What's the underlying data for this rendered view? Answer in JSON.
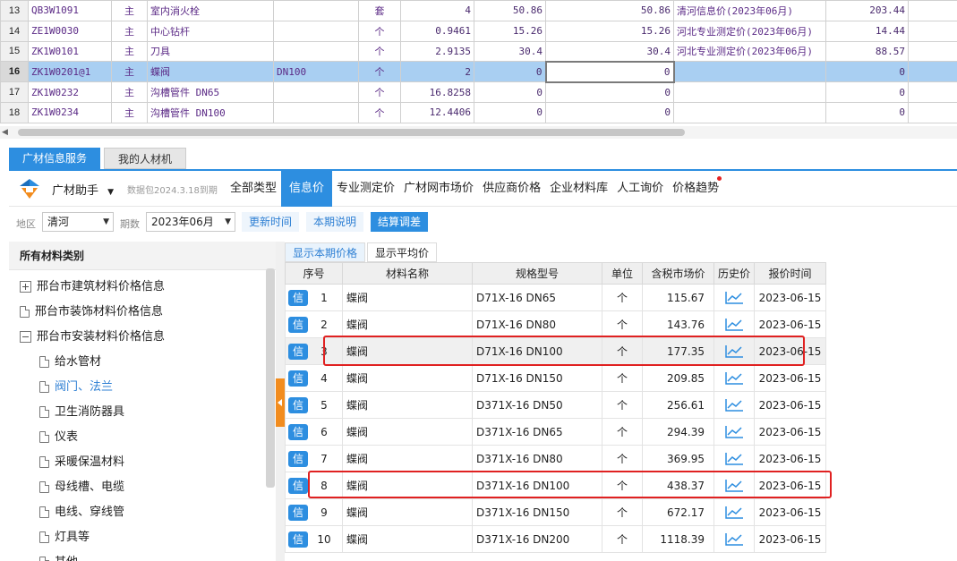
{
  "top_table": {
    "rows": [
      {
        "num": "13",
        "code": "QB3W1091",
        "type": "主",
        "name": "室内消火栓",
        "spec": "",
        "unit": "套",
        "qty": "4",
        "price": "50.86",
        "market": "50.86",
        "source": "清河信息价(2023年06月)",
        "diff": "203.44"
      },
      {
        "num": "14",
        "code": "ZE1W0030",
        "type": "主",
        "name": "中心钻杆",
        "spec": "",
        "unit": "个",
        "qty": "0.9461",
        "price": "15.26",
        "market": "15.26",
        "source": "河北专业测定价(2023年06月)",
        "diff": "14.44"
      },
      {
        "num": "15",
        "code": "ZK1W0101",
        "type": "主",
        "name": "刀具",
        "spec": "",
        "unit": "个",
        "qty": "2.9135",
        "price": "30.4",
        "market": "30.4",
        "source": "河北专业测定价(2023年06月)",
        "diff": "88.57"
      },
      {
        "num": "16",
        "code": "ZK1W0201@1",
        "type": "主",
        "name": "蝶阀",
        "spec": "DN100",
        "unit": "个",
        "qty": "2",
        "price": "0",
        "market": "0",
        "source": "",
        "diff": "0"
      },
      {
        "num": "17",
        "code": "ZK1W0232",
        "type": "主",
        "name": "沟槽管件 DN65",
        "spec": "",
        "unit": "个",
        "qty": "16.8258",
        "price": "0",
        "market": "0",
        "source": "",
        "diff": "0"
      },
      {
        "num": "18",
        "code": "ZK1W0234",
        "type": "主",
        "name": "沟槽管件 DN100",
        "spec": "",
        "unit": "个",
        "qty": "12.4406",
        "price": "0",
        "market": "0",
        "source": "",
        "diff": "0"
      }
    ]
  },
  "tabs_top": {
    "active": "广材信息服务",
    "inactive": "我的人材机"
  },
  "toolbar": {
    "assistant": "广材助手",
    "caret": "▼",
    "version": "数据包2024.3.18到期",
    "nav": [
      "全部类型",
      "信息价",
      "专业测定价",
      "广材网市场价",
      "供应商价格",
      "企业材料库",
      "人工询价",
      "价格趋势"
    ]
  },
  "filters": {
    "region_label": "地区",
    "region": "清河",
    "period_label": "期数",
    "period": "2023年06月",
    "btn_update": "更新时间",
    "btn_desc": "本期说明",
    "btn_settle": "结算调差"
  },
  "left": {
    "header": "所有材料类别",
    "items": [
      "邢台市建筑材料价格信息",
      "邢台市装饰材料价格信息",
      "邢台市安装材料价格信息",
      "给水管材",
      "阀门、法兰",
      "卫生消防器具",
      "仪表",
      "采暖保温材料",
      "母线槽、电缆",
      "电线、穿线管",
      "灯具等",
      "其他"
    ]
  },
  "price_tabs": {
    "current": "显示本期价格",
    "average": "显示平均价"
  },
  "grid": {
    "headers": [
      "序号",
      "材料名称",
      "规格型号",
      "单位",
      "含税市场价",
      "历史价",
      "报价时间"
    ],
    "badge": "信",
    "rows": [
      {
        "no": "1",
        "name": "蝶阀",
        "spec": "D71X-16 DN65",
        "unit": "个",
        "price": "115.67",
        "date": "2023-06-15"
      },
      {
        "no": "2",
        "name": "蝶阀",
        "spec": "D71X-16 DN80",
        "unit": "个",
        "price": "143.76",
        "date": "2023-06-15"
      },
      {
        "no": "3",
        "name": "蝶阀",
        "spec": "D71X-16 DN100",
        "unit": "个",
        "price": "177.35",
        "date": "2023-06-15"
      },
      {
        "no": "4",
        "name": "蝶阀",
        "spec": "D71X-16 DN150",
        "unit": "个",
        "price": "209.85",
        "date": "2023-06-15"
      },
      {
        "no": "5",
        "name": "蝶阀",
        "spec": "D371X-16 DN50",
        "unit": "个",
        "price": "256.61",
        "date": "2023-06-15"
      },
      {
        "no": "6",
        "name": "蝶阀",
        "spec": "D371X-16 DN65",
        "unit": "个",
        "price": "294.39",
        "date": "2023-06-15"
      },
      {
        "no": "7",
        "name": "蝶阀",
        "spec": "D371X-16 DN80",
        "unit": "个",
        "price": "369.95",
        "date": "2023-06-15"
      },
      {
        "no": "8",
        "name": "蝶阀",
        "spec": "D371X-16 DN100",
        "unit": "个",
        "price": "438.37",
        "date": "2023-06-15"
      },
      {
        "no": "9",
        "name": "蝶阀",
        "spec": "D371X-16 DN150",
        "unit": "个",
        "price": "672.17",
        "date": "2023-06-15"
      },
      {
        "no": "10",
        "name": "蝶阀",
        "spec": "D371X-16 DN200",
        "unit": "个",
        "price": "1118.39",
        "date": "2023-06-15"
      }
    ]
  },
  "colors": {
    "accent": "#2d8ee0",
    "selected_row": "#a9cff2",
    "highlight_box": "#e02121",
    "splitter": "#f28c1e"
  }
}
